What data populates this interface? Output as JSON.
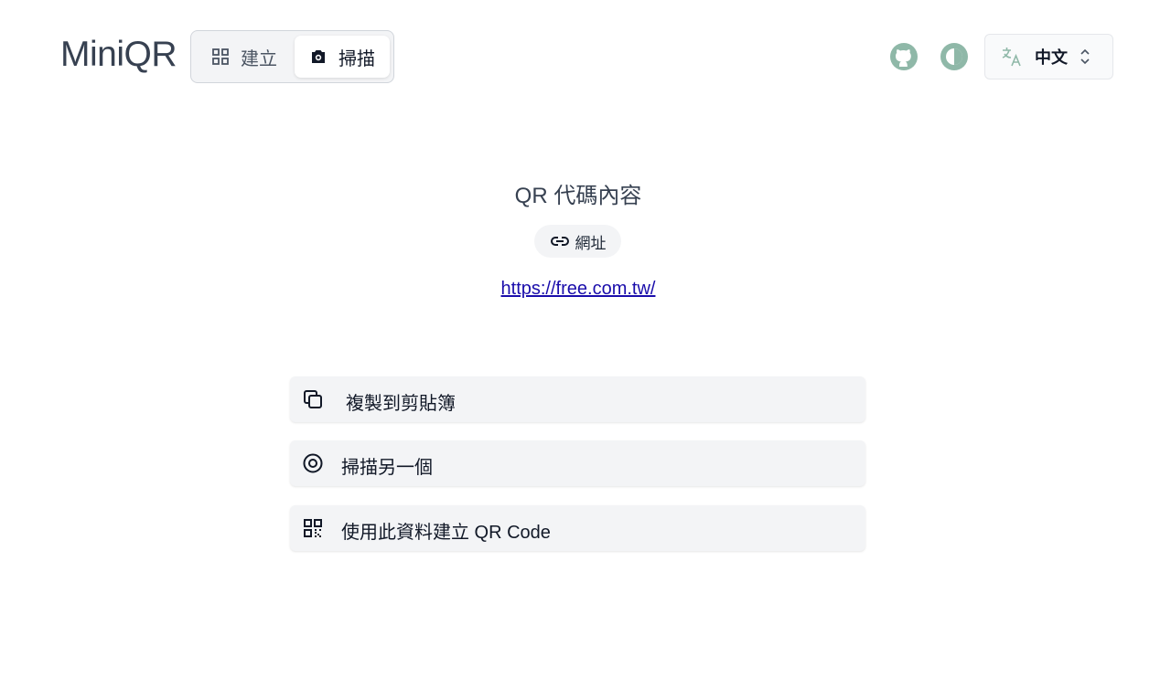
{
  "app": {
    "logo": "MiniQR"
  },
  "mode_switch": {
    "create_label": "建立",
    "scan_label": "掃描",
    "active": "scan"
  },
  "header_icons": [
    "github-icon",
    "theme-toggle-icon",
    "translate-icon"
  ],
  "language": {
    "selected": "中文"
  },
  "result": {
    "title": "QR 代碼內容",
    "type_label": "網址",
    "url": "https://free.com.tw/"
  },
  "actions": [
    {
      "label": "複製到剪貼簿",
      "icon": "copy-icon"
    },
    {
      "label": "掃描另一個",
      "icon": "scan-target-icon"
    },
    {
      "label": "使用此資料建立 QR Code",
      "icon": "qr-code-icon"
    }
  ],
  "colors": {
    "icon_green": "#8fb8a8",
    "link": "#1a0dab",
    "button_bg": "#f3f4f6"
  }
}
